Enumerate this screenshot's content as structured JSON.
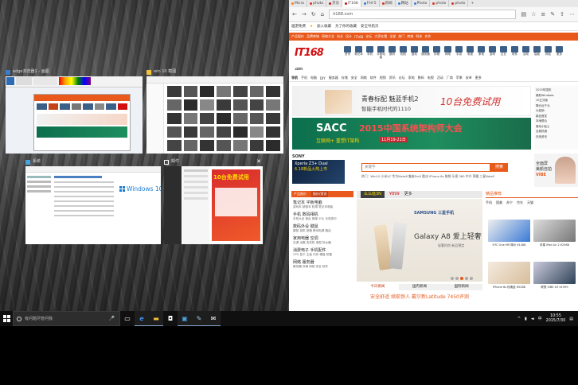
{
  "snap_windows": [
    {
      "title": "edge浏览器1 - 画图",
      "icon": "paint-icon",
      "color": "#3c7ccf"
    },
    {
      "title": "win 10 截图",
      "icon": "folder-icon",
      "color": "#f3c23b"
    },
    {
      "title": "系统",
      "icon": "system-icon",
      "color": "#4aa3df"
    },
    {
      "title": "邮件",
      "icon": "mail-icon",
      "color": "#ffffff"
    }
  ],
  "snap_thumb_text": {
    "win10_logo": "Windows 10",
    "promo": "10台免费试用"
  },
  "browser": {
    "tabs": [
      {
        "label": "Micro",
        "color": "#f48120"
      },
      {
        "label": "photo",
        "color": "#d93025"
      },
      {
        "label": "京东",
        "color": "#c91623"
      },
      {
        "label": "IT168",
        "color": "#d20f10"
      },
      {
        "label": "FHI-5",
        "color": "#2e7dd1"
      },
      {
        "label": "新闻",
        "color": "#d93025"
      },
      {
        "label": "网站",
        "color": "#3c7ccf"
      },
      {
        "label": "Photo",
        "color": "#3c7ccf"
      },
      {
        "label": "photo",
        "color": "#d93025"
      },
      {
        "label": "photo",
        "color": "#d93025"
      }
    ],
    "url": "it168.com",
    "favorites": [
      {
        "label": "提示",
        "icon": "back-icon"
      },
      {
        "label": "加入收藏",
        "icon": "star-icon"
      },
      {
        "label": "更多",
        "icon": "more-icon"
      }
    ],
    "fav_links": [
      "遨游免费",
      "为了你的收藏",
      "安全导航页"
    ],
    "top_strip": [
      "产品报价",
      "品牌商城",
      "网络大全",
      "站长",
      "设计",
      "IT168",
      "论坛",
      "大家在看",
      "全部",
      "热门",
      "商城",
      "科技",
      "合作"
    ],
    "site_logo": "IT168",
    "site_logo_sub": ".com",
    "cat_icons": [
      "资讯",
      "笔记本",
      "手机",
      "平板电脑",
      "数码",
      "相机",
      "整机",
      "服务器",
      "存储",
      "网络",
      "手游",
      "电视",
      "家电",
      "游戏",
      "企业",
      "软件",
      "活动",
      "智能",
      "网站",
      "更多"
    ],
    "nav2": [
      "导航",
      "手机",
      "电脑",
      "DIY",
      "服务器",
      "存储",
      "安全",
      "网络",
      "软件",
      "视频",
      "资讯",
      "论坛",
      "家电",
      "数码",
      "电视",
      "活动",
      "厂商",
      "苹果",
      "安卓",
      "更多"
    ],
    "banner1": {
      "line1": "青春标配 魅蓝手机2",
      "line2": "智能手机时代的1110",
      "promo": "10台免费试用"
    },
    "banner2": {
      "main": "SACC",
      "highlight": "2015中国系统架构师大会",
      "sub": "互联网+ 重塑IT架构",
      "tag": "11月19-21日"
    },
    "right_news": [
      "2015年国庆",
      "微软Windows",
      "10正式版",
      "降价近千元",
      "大促销",
      "新品首发",
      "本地联合",
      "驱动小贴士",
      "全城热销",
      "在线资讯"
    ],
    "sony": {
      "brand": "SONY",
      "model": "Xperia Z3+ Dual",
      "date": "6.18新品火热上市"
    },
    "search": {
      "placeholder": "关键字",
      "button": "搜索"
    },
    "hot_words": "热门：Win10 小米4C 华为Mate8 魅族Pro5 酷派 iPhone 6s 联想 乐视 360 中兴 荣耀 三星Note5",
    "promo_right": {
      "line1": "全面屏",
      "line2": "美颜自拍",
      "line3": "VIBE"
    },
    "left_list": {
      "tabs": [
        "产品报价",
        "报价/资讯"
      ],
      "groups": [
        {
          "title": "笔记本 平板电脑",
          "items": "游戏本 超极本 轻薄 笔记本电脑"
        },
        {
          "title": "手机 数码相机",
          "items": "手机大全 单反 微单 卡片 手机排行"
        },
        {
          "title": "数码外设 键鼠",
          "items": "键鼠 耳机 音箱 移动电源 路由"
        },
        {
          "title": "家用电器 空调",
          "items": "空调 冰箱 洗衣机 电视 热水器"
        },
        {
          "title": "消费电子 手机配件",
          "items": "CPU 显卡 主板 内存 硬盘 机箱"
        },
        {
          "title": "网络 服务器",
          "items": "服务器 存储 网络 安全 软件"
        }
      ]
    },
    "middle": {
      "hd_left": "么么哒3N",
      "hd_price": "¥899",
      "hd_more": "更多",
      "ad_brand": "SAMSUNG 三星手机",
      "ad_title": "Galaxy A8 爱上轻奢",
      "ad_sub": "轻奢时尚 新品预定",
      "tabs": [
        "今日要闻",
        "国内新闻",
        "国际新闻"
      ],
      "headline": "安全舒适 续航惊人 戴尔新Latitude 7450评测"
    },
    "right_panel": {
      "title": "精品推荐",
      "cats": [
        "手机",
        "国美",
        "苏宁",
        "京东",
        "天猫"
      ],
      "items": [
        {
          "caption": "HTC One M9 降价 ¥1388",
          "color": "#3a7ad6"
        },
        {
          "caption": "苹果 iPad Air 2 ¥2988",
          "color": "#777777"
        },
        {
          "caption": "iPhone 6s 玫瑰金 ¥5288",
          "color": "#d7bd9a"
        },
        {
          "caption": "联想 VIBE X3 ¥1999",
          "color": "#2f4258"
        }
      ]
    }
  },
  "taskbar": {
    "search_placeholder": "有问题尽管问我",
    "apps": [
      {
        "name": "task-view-icon",
        "glyph": "▢",
        "active": false
      },
      {
        "name": "edge-icon",
        "glyph": "e",
        "active": true
      },
      {
        "name": "file-explorer-icon",
        "glyph": "▬",
        "active": true
      },
      {
        "name": "store-icon",
        "glyph": "◘",
        "active": false
      },
      {
        "name": "system-icon",
        "glyph": "▣",
        "active": true
      },
      {
        "name": "paint-icon",
        "glyph": "✎",
        "active": true
      },
      {
        "name": "mail-icon",
        "glyph": "✉",
        "active": true
      }
    ],
    "time": "10:55",
    "date": "2015/7/30"
  }
}
